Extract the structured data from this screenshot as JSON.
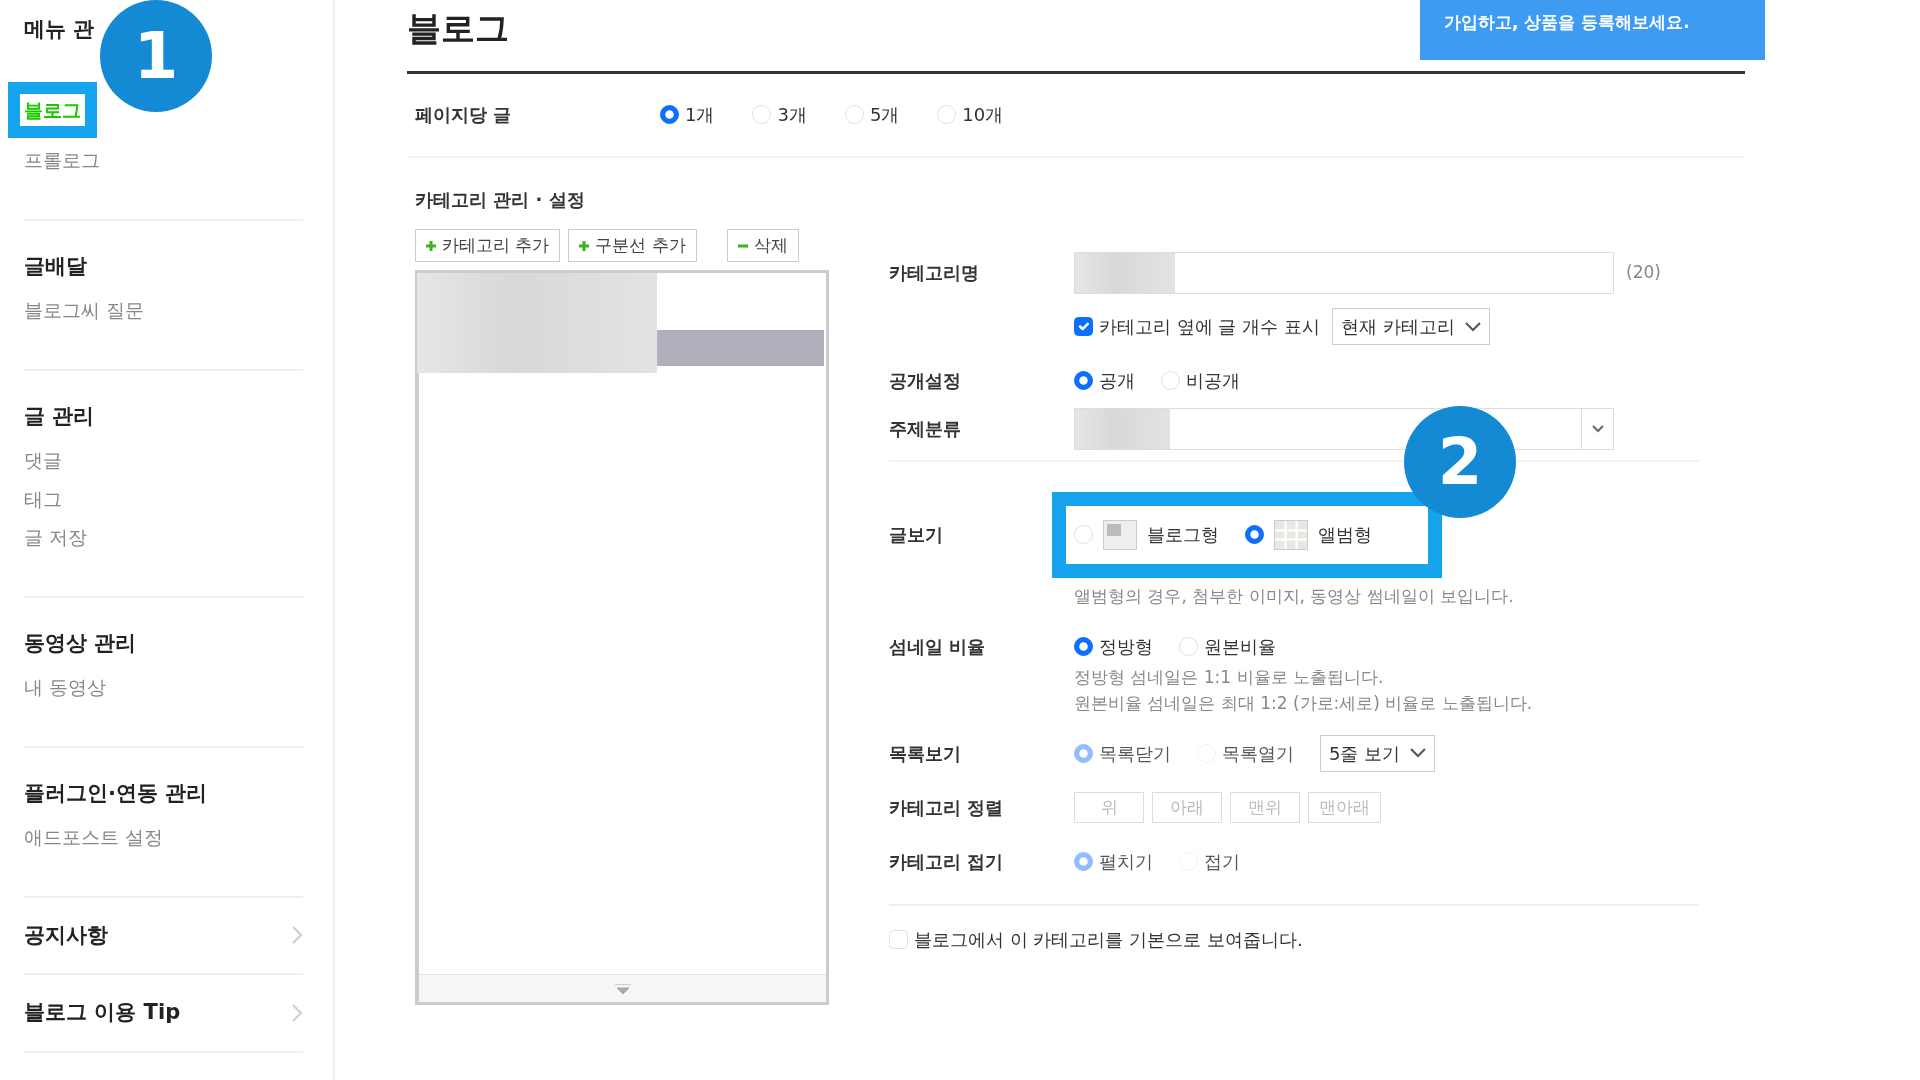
{
  "sidebar": {
    "sections": [
      {
        "title": "메뉴 관",
        "kind": "group",
        "items": [
          {
            "label": "블로그",
            "selected": true
          },
          {
            "label": "프롤로그",
            "selected": false
          }
        ]
      },
      {
        "title": "글배달",
        "kind": "group",
        "items": [
          {
            "label": "블로그씨 질문",
            "selected": false
          }
        ]
      },
      {
        "title": "글 관리",
        "kind": "group",
        "items": [
          {
            "label": "댓글",
            "selected": false
          },
          {
            "label": "태그",
            "selected": false
          },
          {
            "label": "글 저장",
            "selected": false
          }
        ]
      },
      {
        "title": "동영상 관리",
        "kind": "group",
        "items": [
          {
            "label": "내 동영상",
            "selected": false
          }
        ]
      },
      {
        "title": "플러그인·연동 관리",
        "kind": "group",
        "items": [
          {
            "label": "애드포스트 설정",
            "selected": false
          }
        ]
      },
      {
        "title": "공지사항",
        "kind": "link"
      },
      {
        "title": "블로그 이용 Tip",
        "kind": "link"
      }
    ]
  },
  "title": "블로그",
  "banner": "가입하고, 상품을 등록해보세요.",
  "per_page": {
    "label": "페이지당 글",
    "options": [
      {
        "label": "1개",
        "selected": true
      },
      {
        "label": "3개",
        "selected": false
      },
      {
        "label": "5개",
        "selected": false
      },
      {
        "label": "10개",
        "selected": false
      }
    ]
  },
  "category": {
    "heading": "카테고리 관리 · 설정",
    "buttons": [
      {
        "label": "카테고리 추가",
        "kind": "add"
      },
      {
        "label": "구분선 추가",
        "kind": "add"
      },
      {
        "label": "삭제",
        "kind": "remove"
      }
    ]
  },
  "rows": [
    {
      "kind": "text",
      "label": "카테고리명",
      "counter": "(20)"
    },
    {
      "kind": "checkbox",
      "checked": true,
      "text": "카테고리 옆에 글 개수 표시",
      "select": "현재 카테고리"
    },
    {
      "kind": "radio",
      "label": "공개설정",
      "disabled": false,
      "options": [
        {
          "label": "공개",
          "selected": true
        },
        {
          "label": "비공개",
          "selected": false
        }
      ]
    },
    {
      "kind": "select",
      "label": "주제분류"
    },
    {
      "kind": "view",
      "label": "글보기",
      "options": [
        {
          "label": "블로그형",
          "selected": false,
          "kind": "blog"
        },
        {
          "label": "앨범형",
          "selected": true,
          "kind": "album"
        }
      ],
      "hints": [
        "앨범형의 경우, 첨부한 이미지, 동영상 썸네일이 보입니다."
      ]
    },
    {
      "kind": "radio",
      "label": "섬네일 비율",
      "disabled": false,
      "options": [
        {
          "label": "정방형",
          "selected": true
        },
        {
          "label": "원본비율",
          "selected": false
        }
      ],
      "hints": [
        "정방형 섬네일은 1:1 비율로 노출됩니다.",
        "원본비율 섬네일은 최대 1:2 (가로:세로) 비율로 노출됩니다."
      ]
    },
    {
      "kind": "radio",
      "label": "목록보기",
      "disabled": true,
      "options": [
        {
          "label": "목록닫기",
          "selected": true
        },
        {
          "label": "목록열기",
          "selected": false
        }
      ],
      "select": "5줄 보기"
    },
    {
      "kind": "buttons",
      "label": "카테고리 정렬",
      "disabled": true,
      "buttons": [
        "위",
        "아래",
        "맨위",
        "맨아래"
      ]
    },
    {
      "kind": "radio",
      "label": "카테고리 접기",
      "disabled": true,
      "options": [
        {
          "label": "펼치기",
          "selected": true
        },
        {
          "label": "접기",
          "selected": false
        }
      ]
    }
  ],
  "default_option": {
    "checked": false,
    "text": "블로그에서 이 카테고리를 기본으로 보여줍니다."
  },
  "annotations": [
    {
      "number": "1"
    },
    {
      "number": "2"
    }
  ]
}
